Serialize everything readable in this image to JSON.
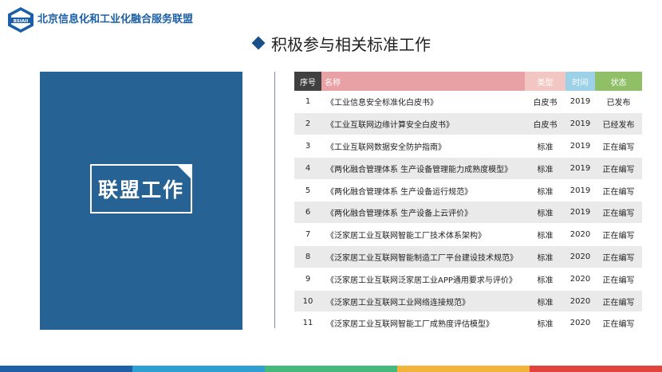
{
  "header": {
    "logo_text": "BSIAII",
    "org_name": "北京信息化和工业化融合服务联盟"
  },
  "page_title": "积极参与相关标准工作",
  "panel": {
    "badge_text": "联盟工作"
  },
  "table": {
    "headers": {
      "no": "序号",
      "name": "名称",
      "type": "类型",
      "time": "时间",
      "status": "状态"
    },
    "rows": [
      {
        "no": "1",
        "name": "《工业信息安全标准化白皮书》",
        "type": "白皮书",
        "time": "2019",
        "status": "已发布"
      },
      {
        "no": "2",
        "name": "《工业互联网边缘计算安全白皮书》",
        "type": "白皮书",
        "time": "2019",
        "status": "已经发布"
      },
      {
        "no": "3",
        "name": "《工业互联网数据安全防护指南》",
        "type": "标准",
        "time": "2019",
        "status": "正在编写"
      },
      {
        "no": "4",
        "name": "《两化融合管理体系 生产设备管理能力成熟度模型》",
        "type": "标准",
        "time": "2019",
        "status": "正在编写"
      },
      {
        "no": "5",
        "name": "《两化融合管理体系 生产设备运行规范》",
        "type": "标准",
        "time": "2019",
        "status": "正在编写"
      },
      {
        "no": "6",
        "name": "《两化融合管理体系 生产设备上云评价》",
        "type": "标准",
        "time": "2019",
        "status": "正在编写"
      },
      {
        "no": "7",
        "name": "《泛家居工业互联网智能工厂技术体系架构》",
        "type": "标准",
        "time": "2020",
        "status": "正在编写"
      },
      {
        "no": "8",
        "name": "《泛家居工业互联网智能制造工厂平台建设技术规范》",
        "type": "标准",
        "time": "2020",
        "status": "正在编写"
      },
      {
        "no": "9",
        "name": "《泛家居工业互联网泛家居工业APP通用要求与评价》",
        "type": "标准",
        "time": "2020",
        "status": "正在编写"
      },
      {
        "no": "10",
        "name": "《泛家居工业互联网工业网络连接规范》",
        "type": "标准",
        "time": "2020",
        "status": "正在编写"
      },
      {
        "no": "11",
        "name": "《泛家居工业互联网智能工厂成熟度评估模型》",
        "type": "标准",
        "time": "2020",
        "status": "正在编写"
      }
    ]
  },
  "colors": {
    "brand": "#1a5fa8",
    "panel": "#266394",
    "bottom_bar": [
      "#1f5fa8",
      "#2e9fd0",
      "#45b97c",
      "#f3b43c",
      "#e2433c"
    ]
  }
}
